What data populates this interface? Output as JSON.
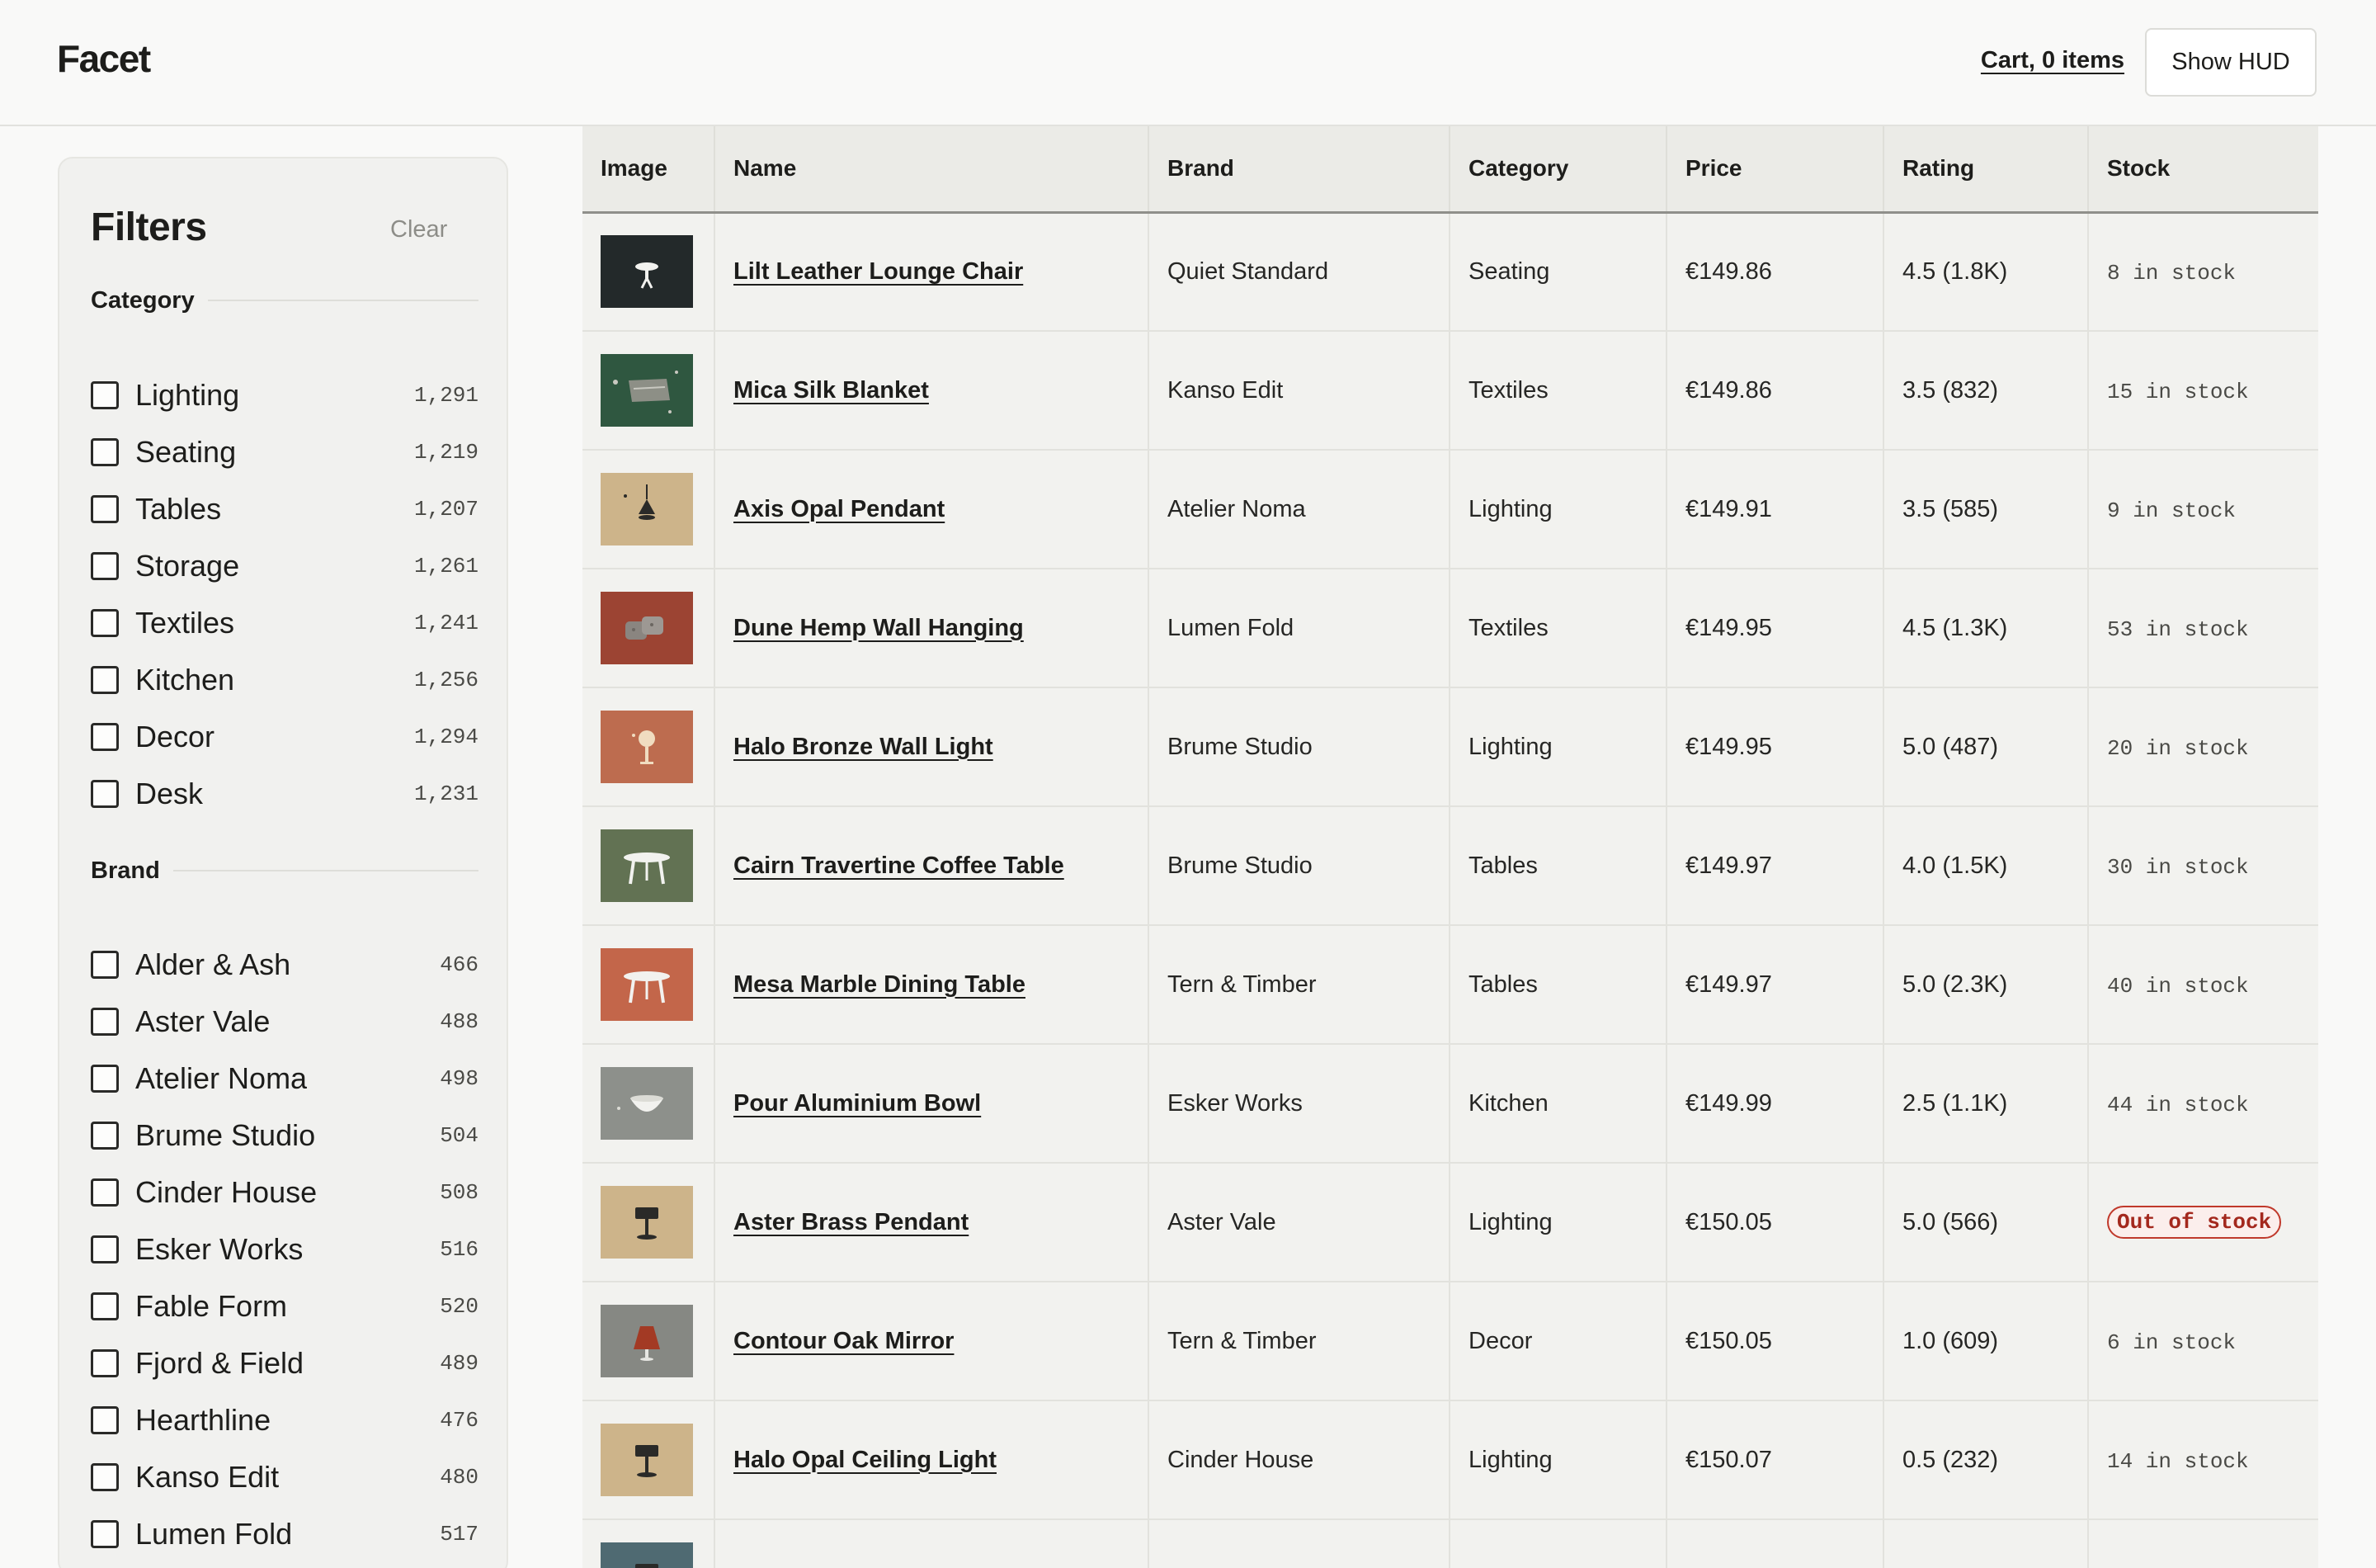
{
  "header": {
    "logo": "Facet",
    "cart_label": "Cart, 0 items",
    "hud_label": "Show HUD"
  },
  "filters": {
    "title": "Filters",
    "clear_label": "Clear",
    "category": {
      "label": "Category",
      "items": [
        {
          "name": "Lighting",
          "count": "1,291"
        },
        {
          "name": "Seating",
          "count": "1,219"
        },
        {
          "name": "Tables",
          "count": "1,207"
        },
        {
          "name": "Storage",
          "count": "1,261"
        },
        {
          "name": "Textiles",
          "count": "1,241"
        },
        {
          "name": "Kitchen",
          "count": "1,256"
        },
        {
          "name": "Decor",
          "count": "1,294"
        },
        {
          "name": "Desk",
          "count": "1,231"
        }
      ]
    },
    "brand": {
      "label": "Brand",
      "items": [
        {
          "name": "Alder & Ash",
          "count": "466"
        },
        {
          "name": "Aster Vale",
          "count": "488"
        },
        {
          "name": "Atelier Noma",
          "count": "498"
        },
        {
          "name": "Brume Studio",
          "count": "504"
        },
        {
          "name": "Cinder House",
          "count": "508"
        },
        {
          "name": "Esker Works",
          "count": "516"
        },
        {
          "name": "Fable Form",
          "count": "520"
        },
        {
          "name": "Fjord & Field",
          "count": "489"
        },
        {
          "name": "Hearthline",
          "count": "476"
        },
        {
          "name": "Kanso Edit",
          "count": "480"
        },
        {
          "name": "Lumen Fold",
          "count": "517"
        }
      ]
    }
  },
  "table": {
    "columns": [
      "Image",
      "Name",
      "Brand",
      "Category",
      "Price",
      "Rating",
      "Stock"
    ],
    "rows": [
      {
        "name": "Lilt Leather Lounge Chair",
        "brand": "Quiet Standard",
        "category": "Seating",
        "price": "€149.86",
        "rating": "4.5 (1.8K)",
        "stock": "8 in stock",
        "out": false,
        "color": "#23292a",
        "icon": "stool-icon"
      },
      {
        "name": "Mica Silk Blanket",
        "brand": "Kanso Edit",
        "category": "Textiles",
        "price": "€149.86",
        "rating": "3.5 (832)",
        "stock": "15 in stock",
        "out": false,
        "color": "#2f5740",
        "icon": "blanket-icon"
      },
      {
        "name": "Axis Opal Pendant",
        "brand": "Atelier Noma",
        "category": "Lighting",
        "price": "€149.91",
        "rating": "3.5 (585)",
        "stock": "9 in stock",
        "out": false,
        "color": "#cdb48a",
        "icon": "pendant-icon"
      },
      {
        "name": "Dune Hemp Wall Hanging",
        "brand": "Lumen Fold",
        "category": "Textiles",
        "price": "€149.95",
        "rating": "4.5 (1.3K)",
        "stock": "53 in stock",
        "out": false,
        "color": "#9c4433",
        "icon": "cushions-icon"
      },
      {
        "name": "Halo Bronze Wall Light",
        "brand": "Brume Studio",
        "category": "Lighting",
        "price": "€149.95",
        "rating": "5.0 (487)",
        "stock": "20 in stock",
        "out": false,
        "color": "#bd6c4f",
        "icon": "wall-light-icon"
      },
      {
        "name": "Cairn Travertine Coffee Table",
        "brand": "Brume Studio",
        "category": "Tables",
        "price": "€149.97",
        "rating": "4.0 (1.5K)",
        "stock": "30 in stock",
        "out": false,
        "color": "#627253",
        "icon": "table-icon"
      },
      {
        "name": "Mesa Marble Dining Table",
        "brand": "Tern & Timber",
        "category": "Tables",
        "price": "€149.97",
        "rating": "5.0 (2.3K)",
        "stock": "40 in stock",
        "out": false,
        "color": "#c3664a",
        "icon": "table-icon"
      },
      {
        "name": "Pour Aluminium Bowl",
        "brand": "Esker Works",
        "category": "Kitchen",
        "price": "€149.99",
        "rating": "2.5 (1.1K)",
        "stock": "44 in stock",
        "out": false,
        "color": "#8d908b",
        "icon": "bowl-icon"
      },
      {
        "name": "Aster Brass Pendant",
        "brand": "Aster Vale",
        "category": "Lighting",
        "price": "€150.05",
        "rating": "5.0 (566)",
        "stock": "Out of stock",
        "out": true,
        "color": "#cdb48a",
        "icon": "lamp-icon"
      },
      {
        "name": "Contour Oak Mirror",
        "brand": "Tern & Timber",
        "category": "Decor",
        "price": "€150.05",
        "rating": "1.0 (609)",
        "stock": "6 in stock",
        "out": false,
        "color": "#868883",
        "icon": "shade-icon"
      },
      {
        "name": "Halo Opal Ceiling Light",
        "brand": "Cinder House",
        "category": "Lighting",
        "price": "€150.07",
        "rating": "0.5 (232)",
        "stock": "14 in stock",
        "out": false,
        "color": "#cdb48a",
        "icon": "lamp-icon"
      },
      {
        "name": "",
        "brand": "",
        "category": "",
        "price": "",
        "rating": "",
        "stock": "",
        "out": false,
        "color": "#4f6a72",
        "icon": "lamp-icon"
      }
    ]
  }
}
